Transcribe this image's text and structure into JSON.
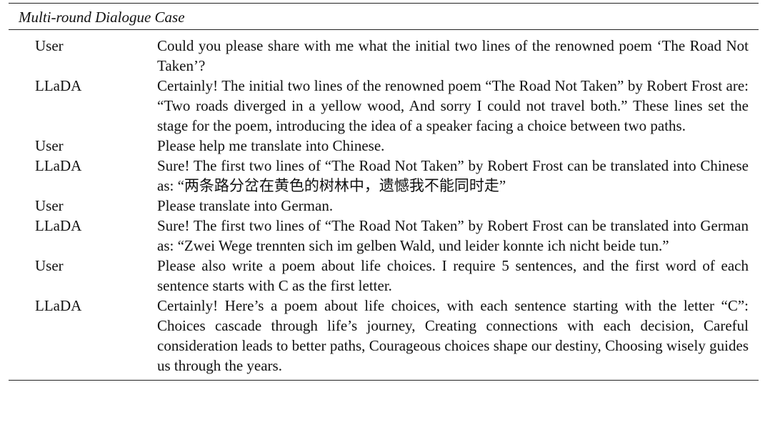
{
  "caption": "Multi-round Dialogue Case",
  "turns": [
    {
      "speaker": "User",
      "text": "Could you please share with me what the initial two lines of the renowned poem ‘The Road Not Taken’?"
    },
    {
      "speaker": "LLaDA",
      "text": "Certainly! The initial two lines of the renowned poem “The Road Not Taken” by Robert Frost are: “Two roads diverged in a yellow wood, And sorry I could not travel both.” These lines set the stage for the poem, introducing the idea of a speaker facing a choice between two paths."
    },
    {
      "speaker": "User",
      "text": "Please help me translate into Chinese."
    },
    {
      "speaker": "LLaDA",
      "text": "Sure! The first two lines of “The Road Not Taken” by Robert Frost can be translated into Chinese as: “两条路分岔在黄色的树林中，遗憾我不能同时走”"
    },
    {
      "speaker": "User",
      "text": "Please translate into German."
    },
    {
      "speaker": "LLaDA",
      "text": "Sure! The first two lines of “The Road Not Taken” by Robert Frost can be translated into German as: “Zwei Wege trennten sich im gelben Wald, und leider konnte ich nicht beide tun.”"
    },
    {
      "speaker": "User",
      "text": "Please also write a poem about life choices. I require 5 sentences, and the first word of each sentence starts with C as the first letter."
    },
    {
      "speaker": "LLaDA",
      "text": "Certainly! Here’s a poem about life choices, with each sentence starting with the letter “C”: Choices cascade through life’s journey, Creating connections with each decision, Careful consideration leads to better paths, Courageous choices shape our destiny, Choosing wisely guides us through the years."
    }
  ]
}
